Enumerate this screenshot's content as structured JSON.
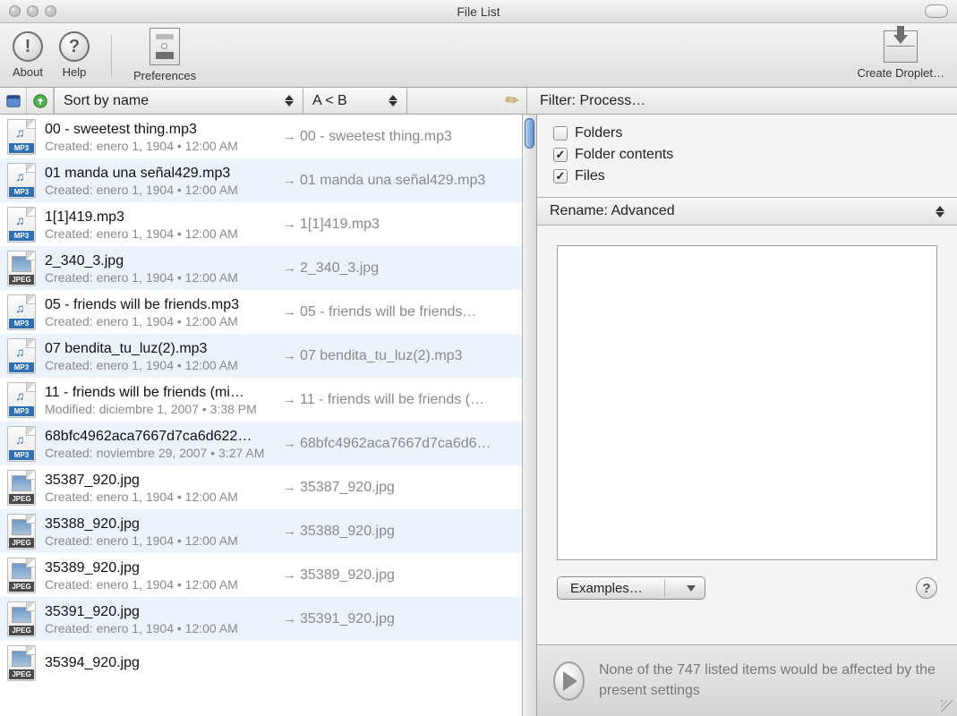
{
  "window": {
    "title": "File List"
  },
  "toolbar": {
    "about": "About",
    "help": "Help",
    "preferences": "Preferences",
    "createDroplet": "Create Droplet…"
  },
  "secondbar": {
    "sort": "Sort by name",
    "order": "A < B",
    "filter": "Filter: Process…"
  },
  "filterChecks": {
    "folders": {
      "label": "Folders",
      "checked": false
    },
    "folderContents": {
      "label": "Folder contents",
      "checked": true
    },
    "files": {
      "label": "Files",
      "checked": true
    }
  },
  "renameHeader": "Rename: Advanced",
  "examplesLabel": "Examples…",
  "status": {
    "summary": "None of the 747 listed items would be affected by the present settings",
    "totalItems": 747
  },
  "files": [
    {
      "icon": "mp3",
      "name": "00 - sweetest thing.mp3",
      "meta": "Created: enero 1, 1904 • 12:00 AM",
      "preview": "00 - sweetest thing.mp3"
    },
    {
      "icon": "mp3",
      "name": "01 manda una señal429.mp3",
      "meta": "Created: enero 1, 1904 • 12:00 AM",
      "preview": "01 manda una señal429.mp3"
    },
    {
      "icon": "mp3",
      "name": "1[1]419.mp3",
      "meta": "Created: enero 1, 1904 • 12:00 AM",
      "preview": "1[1]419.mp3"
    },
    {
      "icon": "jpg",
      "name": "2_340_3.jpg",
      "meta": "Created: enero 1, 1904 • 12:00 AM",
      "preview": "2_340_3.jpg"
    },
    {
      "icon": "mp3",
      "name": "05 - friends will be friends.mp3",
      "meta": "Created: enero 1, 1904 • 12:00 AM",
      "preview": "05 - friends will be friends…"
    },
    {
      "icon": "mp3",
      "name": "07 bendita_tu_luz(2).mp3",
      "meta": "Created: enero 1, 1904 • 12:00 AM",
      "preview": "07 bendita_tu_luz(2).mp3"
    },
    {
      "icon": "mp3",
      "name": "11 - friends will be friends (mi…",
      "meta": "Modified: diciembre 1, 2007 • 3:38 PM",
      "preview": "11 - friends will be friends (…"
    },
    {
      "icon": "mp3",
      "name": "68bfc4962aca7667d7ca6d622…",
      "meta": "Created: noviembre 29, 2007 • 3:27 AM",
      "preview": "68bfc4962aca7667d7ca6d6…"
    },
    {
      "icon": "jpg",
      "name": "35387_920.jpg",
      "meta": "Created: enero 1, 1904 • 12:00 AM",
      "preview": "35387_920.jpg"
    },
    {
      "icon": "jpg",
      "name": "35388_920.jpg",
      "meta": "Created: enero 1, 1904 • 12:00 AM",
      "preview": "35388_920.jpg"
    },
    {
      "icon": "jpg",
      "name": "35389_920.jpg",
      "meta": "Created: enero 1, 1904 • 12:00 AM",
      "preview": "35389_920.jpg"
    },
    {
      "icon": "jpg",
      "name": "35391_920.jpg",
      "meta": "Created: enero 1, 1904 • 12:00 AM",
      "preview": "35391_920.jpg"
    },
    {
      "icon": "jpg",
      "name": "35394_920.jpg",
      "meta": "",
      "preview": ""
    }
  ],
  "iconTags": {
    "mp3": "MP3",
    "jpg": "JPEG"
  }
}
